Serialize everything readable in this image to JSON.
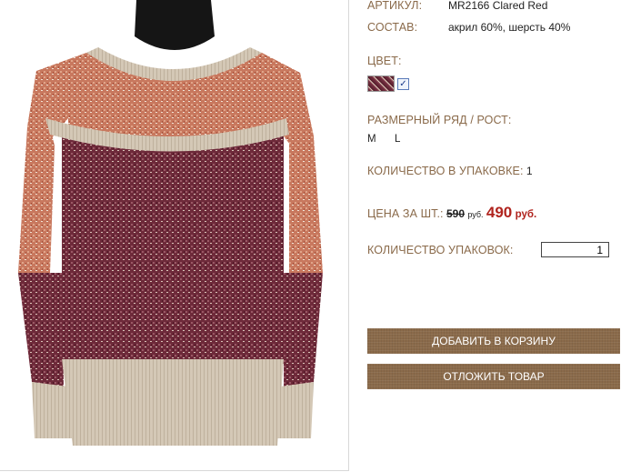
{
  "product": {
    "article_label": "АРТИКУЛ:",
    "article_value": "MR2166 Clared Red",
    "composition_label": "СОСТАВ:",
    "composition_value": "акрил 60%, шерсть 40%",
    "color_label": "ЦВЕТ:",
    "color_checkbox": "✓",
    "size_label": "РАЗМЕРНЫЙ РЯД / РОСТ:",
    "sizes": [
      "M",
      "L"
    ],
    "pack_qty_label": "КОЛИЧЕСТВО В УПАКОВКЕ:",
    "pack_qty_value": "1",
    "price_label": "ЦЕНА ЗА ШТ.:",
    "old_price": "590",
    "old_currency": "руб.",
    "new_price": "490",
    "new_currency": "руб.",
    "packs_label": "КОЛИЧЕСТВО УПАКОВОК:",
    "packs_value": "1"
  },
  "buttons": {
    "add_to_cart": "ДОБАВИТЬ В КОРЗИНУ",
    "postpone": "ОТЛОЖИТЬ ТОВАР"
  },
  "colors": {
    "label": "#8a6a4a",
    "price_red": "#b0241e",
    "button": "#8a6a4a"
  }
}
